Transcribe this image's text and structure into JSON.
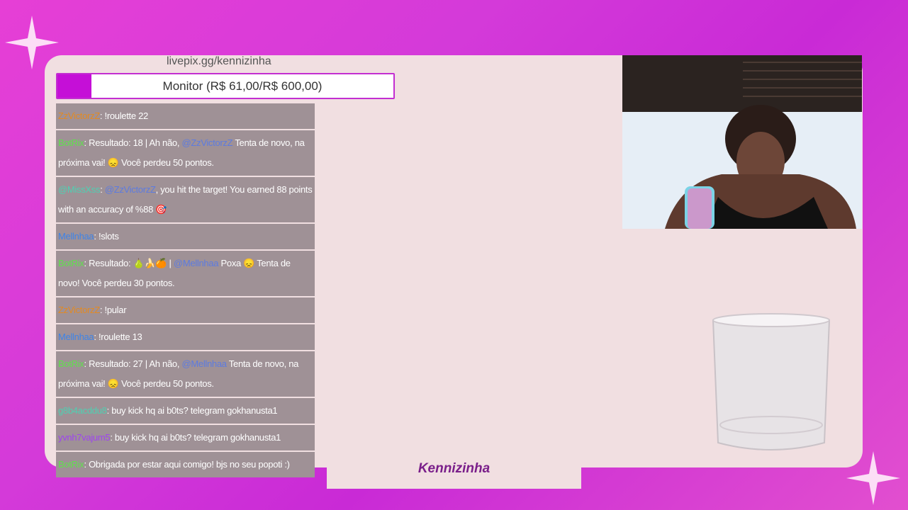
{
  "overlay": {
    "url": "livepix.gg/kennizinha",
    "monitor": {
      "label": "Monitor (R$ 61,00/R$ 600,00)",
      "progress": 0.1017
    },
    "streamer_name": "Kennizinha"
  },
  "chat": [
    {
      "user": "ZzVictorzZ",
      "user_color": "orange",
      "text": ": !roulette 22"
    },
    {
      "user": "BotRix",
      "user_color": "green",
      "text": ": Resultado: 18 | Ah não, ",
      "mention": "@ZzVictorzZ",
      "text2": " Tenta de novo, na próxima vai! 😞 Você perdeu 50 pontos."
    },
    {
      "user": "@MissXss",
      "user_color": "teal",
      "text": ": ",
      "mention": "@ZzVictorzZ",
      "text2": ", you hit the target! You earned 88 points with an accuracy of %88 🎯"
    },
    {
      "user": "Mellnhaa",
      "user_color": "blue",
      "text": ": !slots"
    },
    {
      "user": "BotRix",
      "user_color": "green",
      "text": ": Resultado: 🍐🍌🍊 | ",
      "mention": "@Mellnhaa",
      "text2": " Poxa 😞 Tenta de novo! Você perdeu 30 pontos."
    },
    {
      "user": "ZzVictorzZ",
      "user_color": "orange",
      "text": ": !pular"
    },
    {
      "user": "Mellnhaa",
      "user_color": "blue",
      "text": ": !roulette 13"
    },
    {
      "user": "BotRix",
      "user_color": "green",
      "text": ": Resultado: 27 | Ah não, ",
      "mention": "@Mellnhaa",
      "text2": " Tenta de novo, na próxima vai! 😞 Você perdeu 50 pontos."
    },
    {
      "user": "g8b4acddu8",
      "user_color": "teal",
      "text": ": buy kick hq ai b0ts? telegram gokhanusta1"
    },
    {
      "user": "yvnh7vajum5",
      "user_color": "purple",
      "text": ": buy kick hq ai b0ts? telegram gokhanusta1"
    },
    {
      "user": "BotRix",
      "user_color": "green",
      "text": ": Obrigada por estar aqui comigo! bjs no seu popoti :)"
    }
  ],
  "colors": {
    "background": "#d43ad9",
    "panel": "#f1dfe1",
    "monitor_fill": "#c50fd7",
    "chat_bg": "#9f9196"
  }
}
